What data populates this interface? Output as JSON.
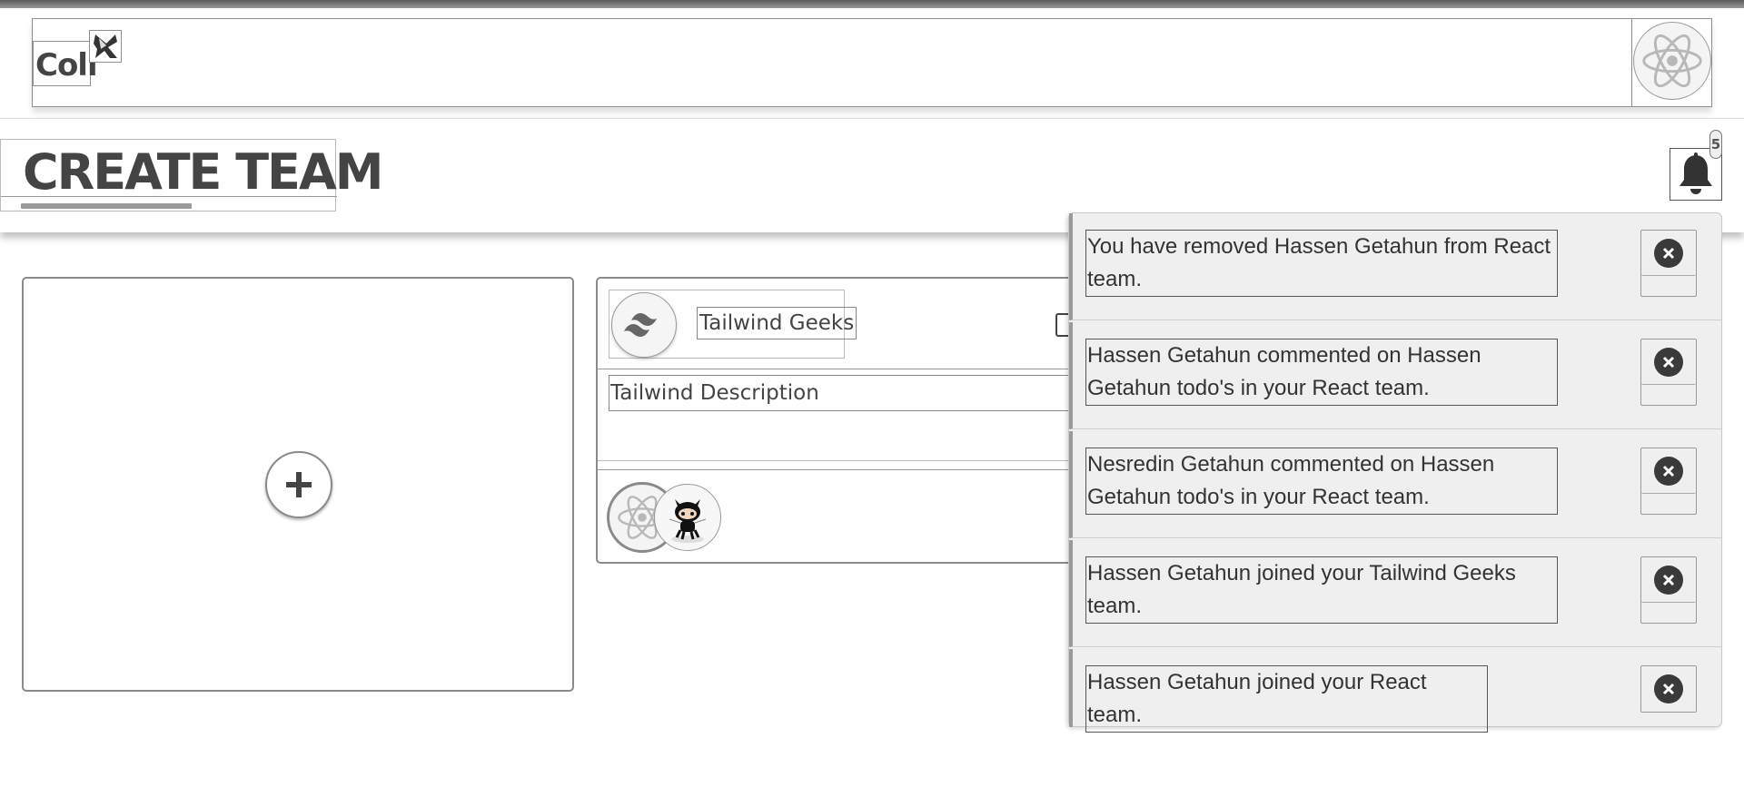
{
  "app": {
    "logo_text": "Coli"
  },
  "page": {
    "title": "CREATE TEAM"
  },
  "notifications": {
    "count": "5",
    "items": [
      {
        "text": "You have removed Hassen Getahun from React team."
      },
      {
        "text": "Hassen Getahun commented on Hassen Getahun todo's in your React team."
      },
      {
        "text": "Nesredin Getahun commented on Hassen Getahun todo's in your React team."
      },
      {
        "text": "Hassen Getahun joined your Tailwind Geeks team."
      },
      {
        "text": "Hassen Getahun joined your React team."
      }
    ]
  },
  "add_card": {
    "icon": "plus-icon"
  },
  "team_card": {
    "name": "Tailwind Geeks",
    "description": "Tailwind Description",
    "logo_icon": "tailwind-icon",
    "members": [
      "react-icon",
      "github-octocat-icon"
    ]
  },
  "header": {
    "avatar_icon": "react-icon"
  }
}
